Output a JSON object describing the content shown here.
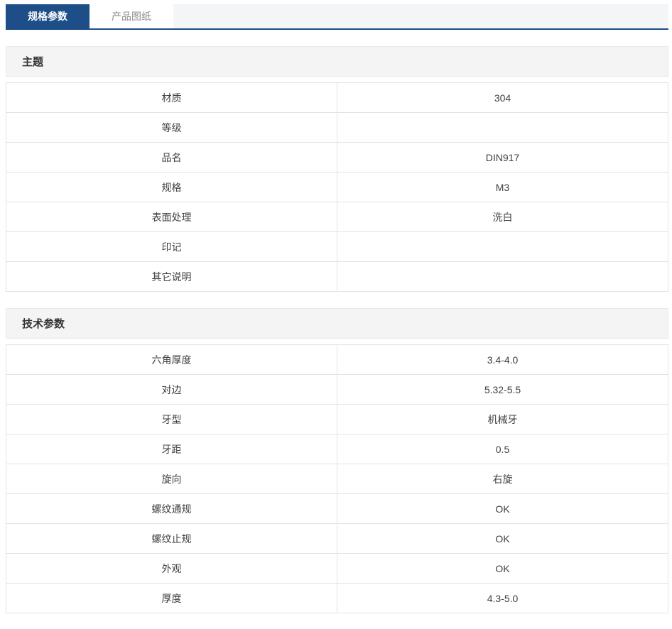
{
  "tabs": [
    {
      "label": "规格参数",
      "active": true
    },
    {
      "label": "产品图纸",
      "active": false
    }
  ],
  "sections": [
    {
      "title": "主题",
      "rows": [
        {
          "label": "材质",
          "value": "304"
        },
        {
          "label": "等级",
          "value": ""
        },
        {
          "label": "品名",
          "value": "DIN917"
        },
        {
          "label": "规格",
          "value": "M3"
        },
        {
          "label": "表面处理",
          "value": "洗白"
        },
        {
          "label": "印记",
          "value": ""
        },
        {
          "label": "其它说明",
          "value": ""
        }
      ]
    },
    {
      "title": "技术参数",
      "rows": [
        {
          "label": "六角厚度",
          "value": "3.4-4.0"
        },
        {
          "label": "对边",
          "value": "5.32-5.5"
        },
        {
          "label": "牙型",
          "value": "机械牙"
        },
        {
          "label": "牙距",
          "value": "0.5"
        },
        {
          "label": "旋向",
          "value": "右旋"
        },
        {
          "label": "螺纹通规",
          "value": "OK"
        },
        {
          "label": "螺纹止规",
          "value": "OK"
        },
        {
          "label": "外观",
          "value": "OK"
        },
        {
          "label": "厚度",
          "value": "4.3-5.0"
        }
      ]
    }
  ],
  "colors": {
    "accent": "#1d4e87",
    "tabbar_bg": "#f4f5f6",
    "tab_inactive_text": "#8c8c8c",
    "section_bg": "#f4f4f5",
    "section_border": "#eaeaec",
    "table_border": "#e3e3e5",
    "text": "#404040"
  }
}
